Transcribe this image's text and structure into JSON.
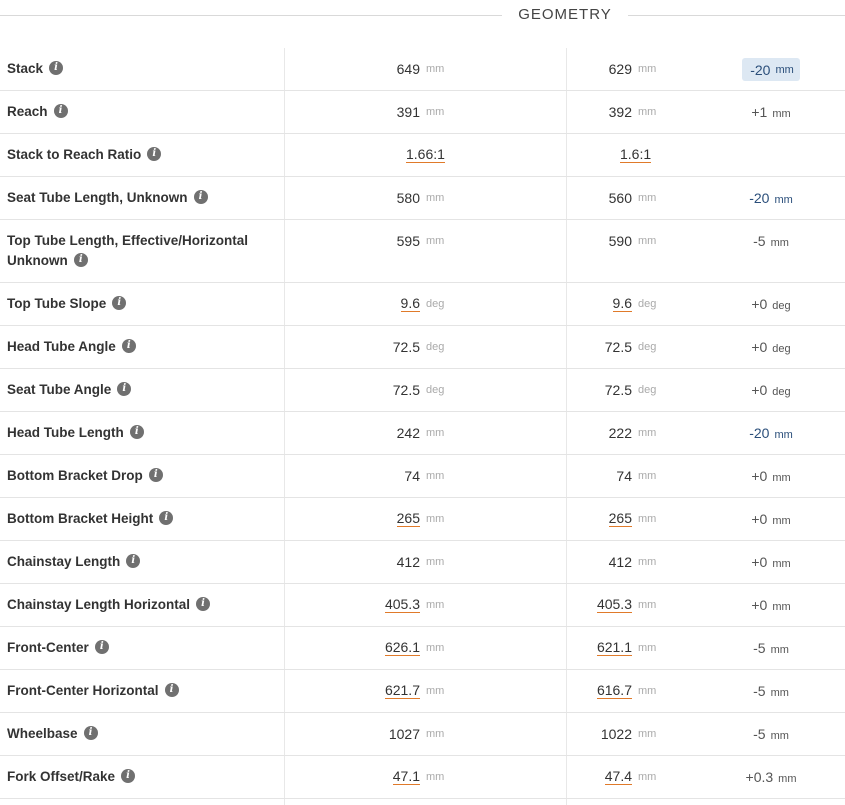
{
  "header": {
    "title": "GEOMETRY"
  },
  "rows": [
    {
      "label": "Stack",
      "v1": "649",
      "u1": "mm",
      "v2": "629",
      "u2": "mm",
      "diff": "-20",
      "diff_unit": "mm",
      "ul1": false,
      "ul2": false,
      "neg": true,
      "highlight": true
    },
    {
      "label": "Reach",
      "v1": "391",
      "u1": "mm",
      "v2": "392",
      "u2": "mm",
      "diff": "+1",
      "diff_unit": "mm",
      "ul1": false,
      "ul2": false
    },
    {
      "label": "Stack to Reach Ratio",
      "v1": "1.66:1",
      "u1": "",
      "v2": "1.6:1",
      "u2": "",
      "diff": "",
      "diff_unit": "",
      "ul1": true,
      "ul2": true,
      "ratio": true
    },
    {
      "label": "Seat Tube Length, Unknown",
      "v1": "580",
      "u1": "mm",
      "v2": "560",
      "u2": "mm",
      "diff": "-20",
      "diff_unit": "mm",
      "neg": true
    },
    {
      "label": "Top Tube Length, Effective/Horizontal Unknown",
      "v1": "595",
      "u1": "mm",
      "v2": "590",
      "u2": "mm",
      "diff": "-5",
      "diff_unit": "mm",
      "multi": true
    },
    {
      "label": "Top Tube Slope",
      "v1": "9.6",
      "u1": "deg",
      "v2": "9.6",
      "u2": "deg",
      "diff": "+0",
      "diff_unit": "deg",
      "ul1": true,
      "ul2": true
    },
    {
      "label": "Head Tube Angle",
      "v1": "72.5",
      "u1": "deg",
      "v2": "72.5",
      "u2": "deg",
      "diff": "+0",
      "diff_unit": "deg"
    },
    {
      "label": "Seat Tube Angle",
      "v1": "72.5",
      "u1": "deg",
      "v2": "72.5",
      "u2": "deg",
      "diff": "+0",
      "diff_unit": "deg"
    },
    {
      "label": "Head Tube Length",
      "v1": "242",
      "u1": "mm",
      "v2": "222",
      "u2": "mm",
      "diff": "-20",
      "diff_unit": "mm",
      "neg": true
    },
    {
      "label": "Bottom Bracket Drop",
      "v1": "74",
      "u1": "mm",
      "v2": "74",
      "u2": "mm",
      "diff": "+0",
      "diff_unit": "mm"
    },
    {
      "label": "Bottom Bracket Height",
      "v1": "265",
      "u1": "mm",
      "v2": "265",
      "u2": "mm",
      "diff": "+0",
      "diff_unit": "mm",
      "ul1": true,
      "ul2": true
    },
    {
      "label": "Chainstay Length",
      "v1": "412",
      "u1": "mm",
      "v2": "412",
      "u2": "mm",
      "diff": "+0",
      "diff_unit": "mm"
    },
    {
      "label": "Chainstay Length Horizontal",
      "v1": "405.3",
      "u1": "mm",
      "v2": "405.3",
      "u2": "mm",
      "diff": "+0",
      "diff_unit": "mm",
      "ul1": true,
      "ul2": true
    },
    {
      "label": "Front-Center",
      "v1": "626.1",
      "u1": "mm",
      "v2": "621.1",
      "u2": "mm",
      "diff": "-5",
      "diff_unit": "mm",
      "ul1": true,
      "ul2": true
    },
    {
      "label": "Front-Center Horizontal",
      "v1": "621.7",
      "u1": "mm",
      "v2": "616.7",
      "u2": "mm",
      "diff": "-5",
      "diff_unit": "mm",
      "ul1": true,
      "ul2": true
    },
    {
      "label": "Wheelbase",
      "v1": "1027",
      "u1": "mm",
      "v2": "1022",
      "u2": "mm",
      "diff": "-5",
      "diff_unit": "mm"
    },
    {
      "label": "Fork Offset/Rake",
      "v1": "47.1",
      "u1": "mm",
      "v2": "47.4",
      "u2": "mm",
      "diff": "+0.3",
      "diff_unit": "mm",
      "ul1": true,
      "ul2": true
    }
  ],
  "colors": {
    "negative_diff": "#2a4e7a",
    "highlight_bg": "#dde8f3",
    "underline": "#e07a2a"
  },
  "icons": {
    "info": "info-icon"
  },
  "info_glyph": "i"
}
